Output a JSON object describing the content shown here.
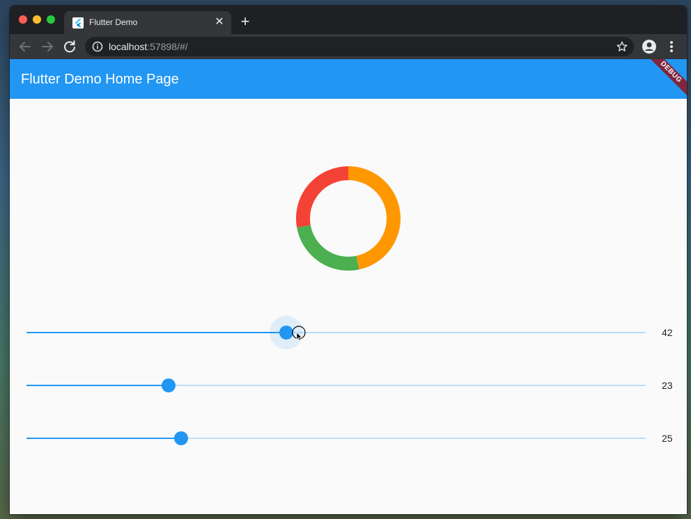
{
  "browser": {
    "tab_title": "Flutter Demo",
    "url_host": "localhost",
    "url_rest": ":57898/#/"
  },
  "app": {
    "title": "Flutter Demo Home Page",
    "debug_banner": "DEBUG",
    "accent_color": "#2196f3"
  },
  "donut": {
    "segments": [
      {
        "color": "#ff9800",
        "value": 42
      },
      {
        "color": "#4caf50",
        "value": 23
      },
      {
        "color": "#f44336",
        "value": 25
      }
    ]
  },
  "sliders": [
    {
      "value": 42,
      "label": "42",
      "min": 0,
      "max": 100,
      "focused": true
    },
    {
      "value": 23,
      "label": "23",
      "min": 0,
      "max": 100,
      "focused": false
    },
    {
      "value": 25,
      "label": "25",
      "min": 0,
      "max": 100,
      "focused": false
    }
  ]
}
